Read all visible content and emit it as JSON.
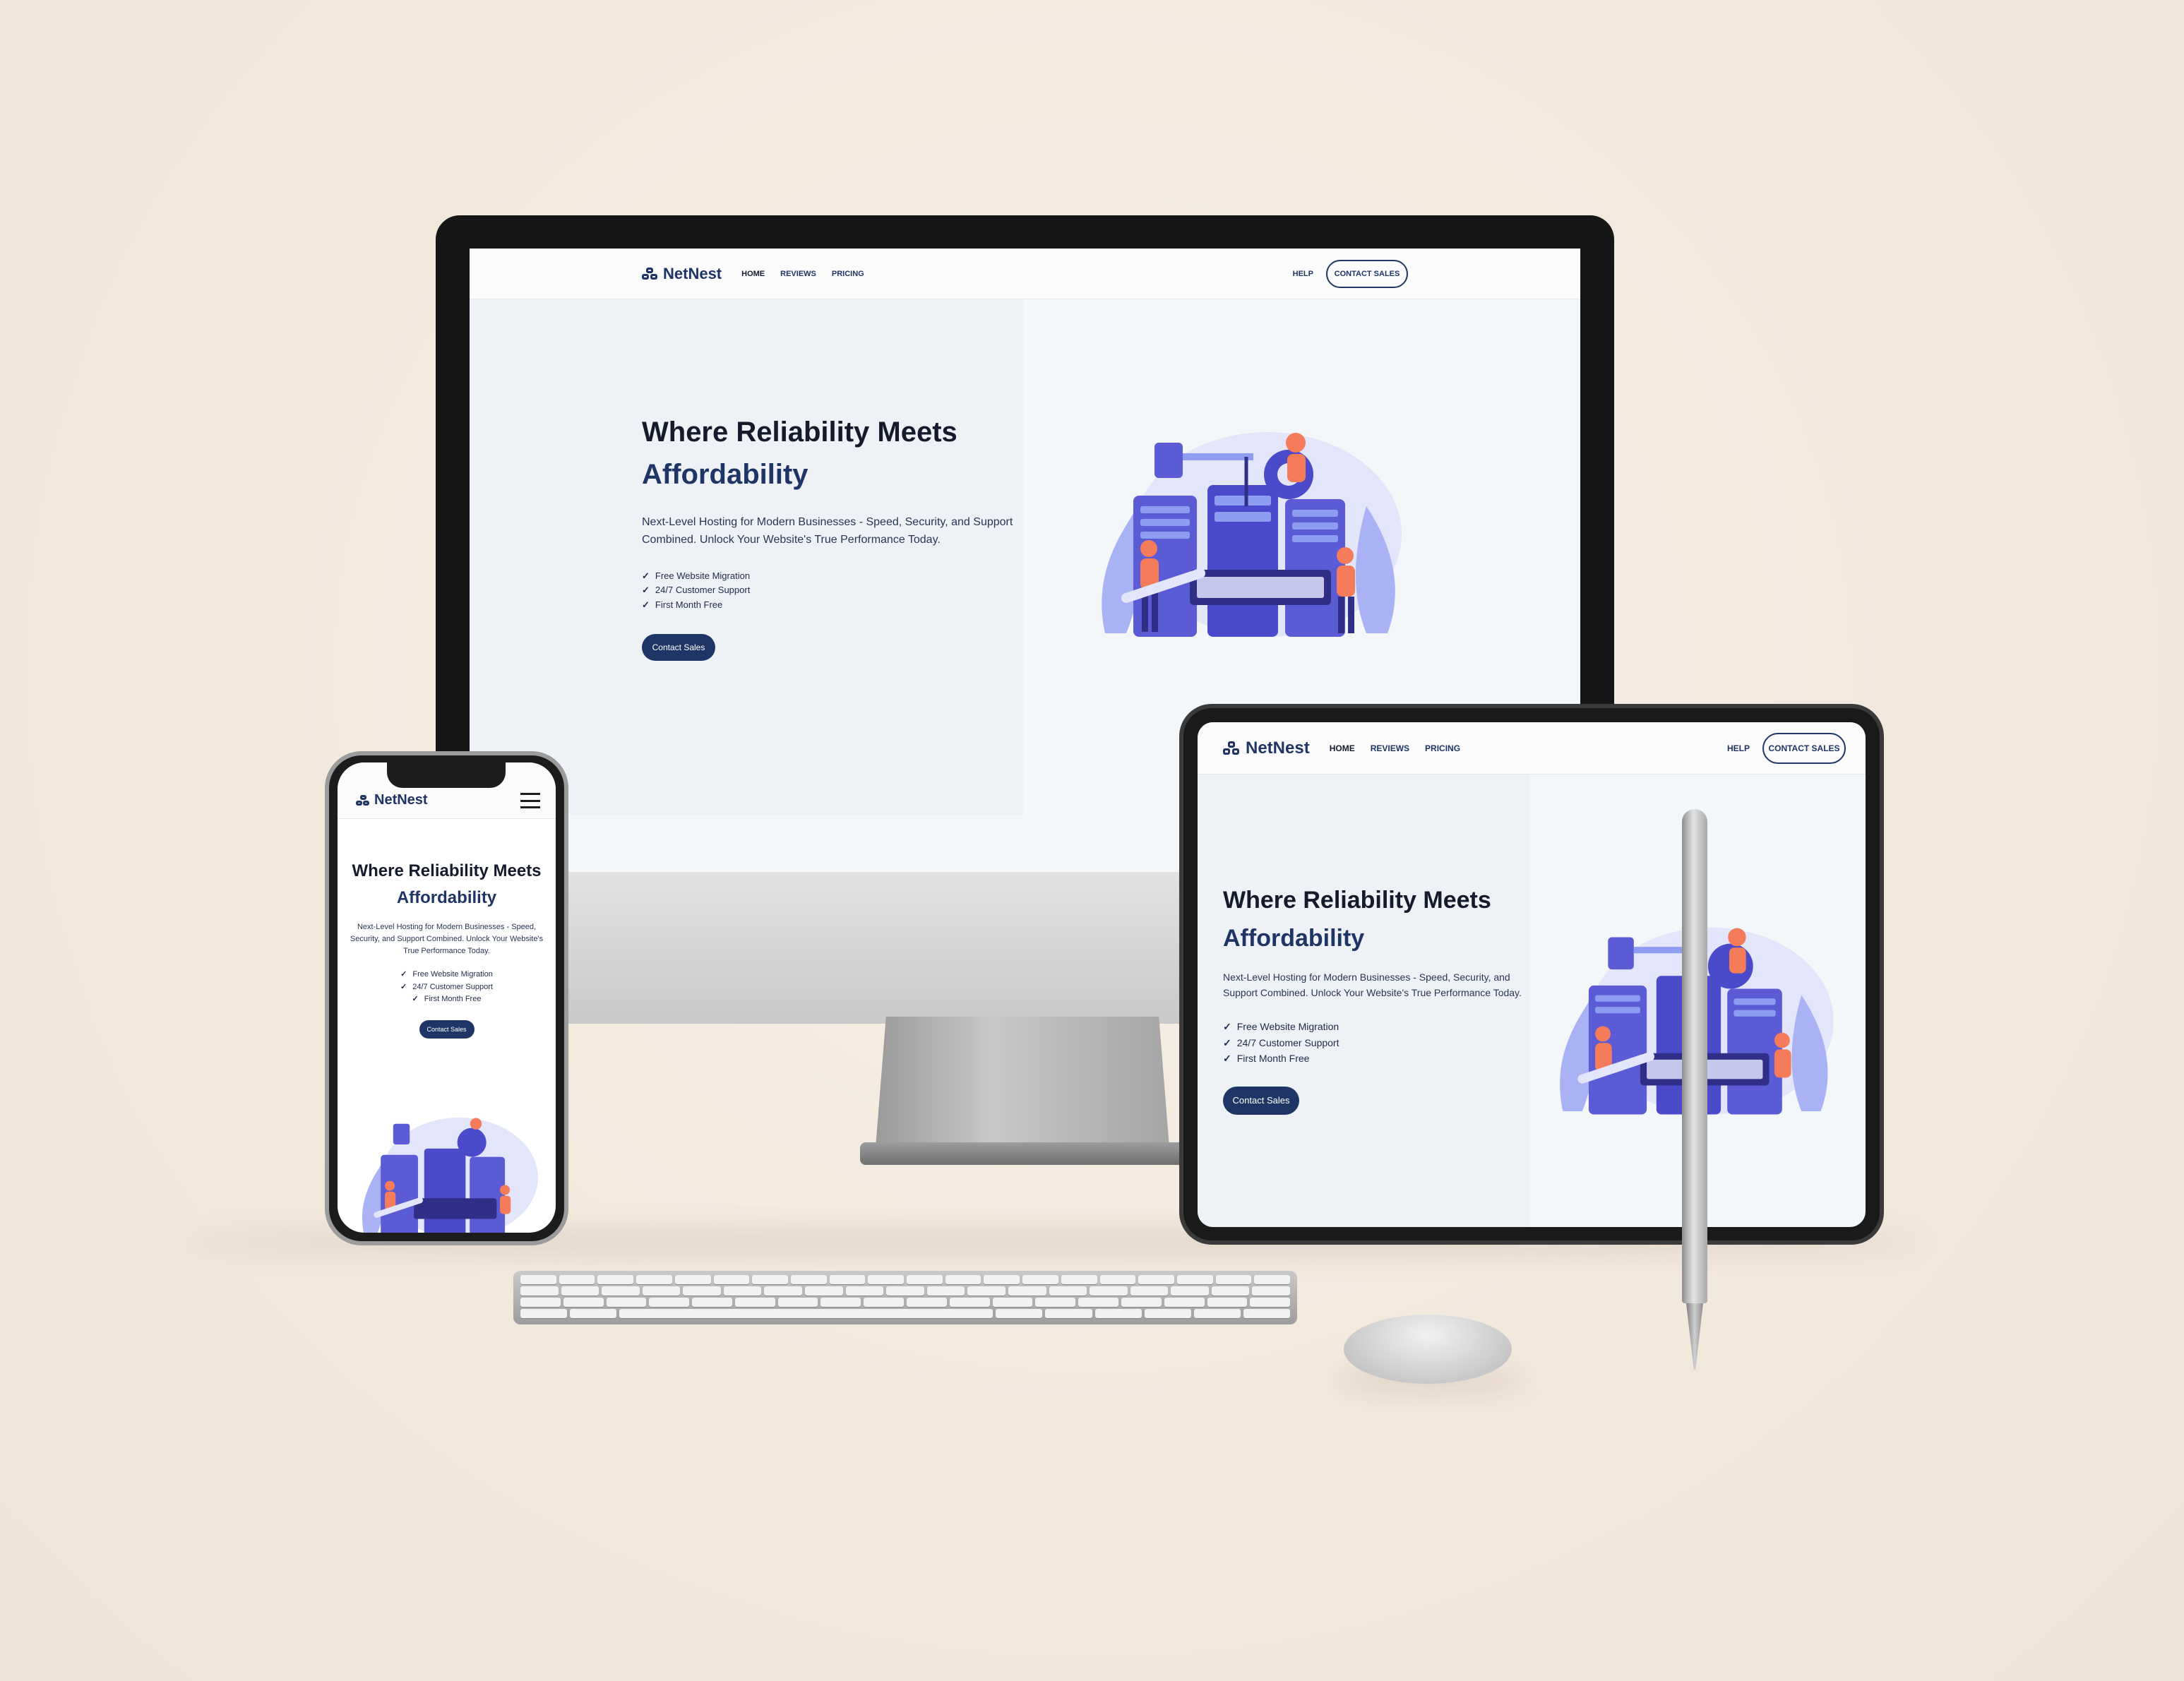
{
  "brand": {
    "name": "NetNest",
    "logo_icon": "network-nodes-icon",
    "accent_color": "#1e3566",
    "illustration_colors": [
      "#5b5bd6",
      "#8e9cf2",
      "#f47c5a"
    ]
  },
  "nav": {
    "links": [
      {
        "label": "HOME",
        "active": true
      },
      {
        "label": "REVIEWS",
        "active": false
      },
      {
        "label": "PRICING",
        "active": false
      }
    ],
    "help_label": "HELP",
    "contact_label": "CONTACT SALES",
    "menu_icon": "hamburger-menu-icon"
  },
  "hero": {
    "title_line1": "Where Reliability Meets",
    "title_accent": "Affordability",
    "subtitle": "Next-Level Hosting for Modern Businesses - Speed, Security, and Support Combined. Unlock Your Website's True Performance Today.",
    "features": [
      "Free Website Migration",
      "24/7 Customer Support",
      "First Month Free"
    ],
    "check_mark": "✓",
    "cta_label": "Contact Sales",
    "illustration": "server-maintenance-illustration"
  }
}
